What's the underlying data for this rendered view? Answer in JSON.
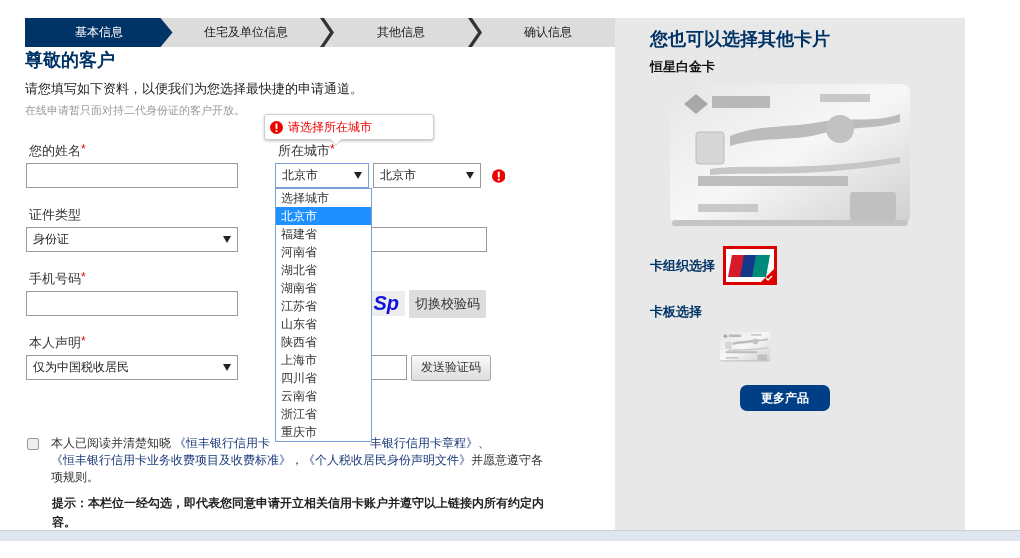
{
  "steps": [
    {
      "label": "基本信息",
      "selected": true
    },
    {
      "label": "住宅及单位信息",
      "selected": false
    },
    {
      "label": "其他信息",
      "selected": false
    },
    {
      "label": "确认信息",
      "selected": false
    }
  ],
  "heading": "尊敬的客户",
  "intro": "请您填写如下资料，以便我们为您选择最快捷的申请通道。",
  "note": "在线申请暂只面对持二代身份证的客户开放。",
  "tooltip": "请选择所在城市",
  "required_mark": "*",
  "left_fields": [
    {
      "label": "您的姓名",
      "required": true,
      "kind": "input"
    },
    {
      "label": "证件类型",
      "required": false,
      "kind": "select",
      "value": "身份证"
    },
    {
      "label": "手机号码",
      "required": true,
      "kind": "input"
    },
    {
      "label": "本人声明",
      "required": true,
      "kind": "select",
      "value": "仅为中国税收居民"
    }
  ],
  "city": {
    "label": "所在城市",
    "required": true,
    "selects": [
      "北京市",
      "北京市"
    ],
    "error": true,
    "options": [
      {
        "label": "选择城市",
        "selected": false
      },
      {
        "label": "北京市",
        "selected": true
      },
      {
        "label": "福建省",
        "selected": false
      },
      {
        "label": "河南省",
        "selected": false
      },
      {
        "label": "湖北省",
        "selected": false
      },
      {
        "label": "湖南省",
        "selected": false
      },
      {
        "label": "江苏省",
        "selected": false
      },
      {
        "label": "山东省",
        "selected": false
      },
      {
        "label": "陕西省",
        "selected": false
      },
      {
        "label": "上海市",
        "selected": false
      },
      {
        "label": "四川省",
        "selected": false
      },
      {
        "label": "云南省",
        "selected": false
      },
      {
        "label": "浙江省",
        "selected": false
      },
      {
        "label": "重庆市",
        "selected": false
      }
    ]
  },
  "right_rows": [
    {
      "kind": "input"
    },
    {
      "kind": "captcha",
      "captcha": "Sp",
      "button": "切换校验码"
    },
    {
      "kind": "sms",
      "button": "发送验证码"
    }
  ],
  "consent": {
    "checked": false,
    "segments": [
      {
        "kind": "text",
        "text": "本人已阅读并清楚知晓 "
      },
      {
        "kind": "link",
        "text": "《恒丰银行信用卡"
      },
      {
        "kind": "hidden"
      },
      {
        "kind": "link",
        "text": "丰银行信用卡章程》"
      },
      {
        "kind": "text",
        "text": "、 "
      },
      {
        "kind": "link",
        "text": "《恒丰银行信用卡业务收费项目及收费标准》"
      },
      {
        "kind": "text",
        "text": "，"
      },
      {
        "kind": "link",
        "text": "《个人税收居民身份声明文件》"
      },
      {
        "kind": "text",
        "text": "并愿意遵守各项规则。"
      }
    ]
  },
  "hint": "提示：本栏位一经勾选，即代表您同意申请开立相关信用卡账户并遵守以上链接内所有约定内容。",
  "side": {
    "title": "您也可以选择其他卡片",
    "card_name": "恒星白金卡",
    "network_label": "卡组织选择",
    "network_selected": true,
    "design_label": "卡板选择",
    "more_button": "更多产品"
  }
}
